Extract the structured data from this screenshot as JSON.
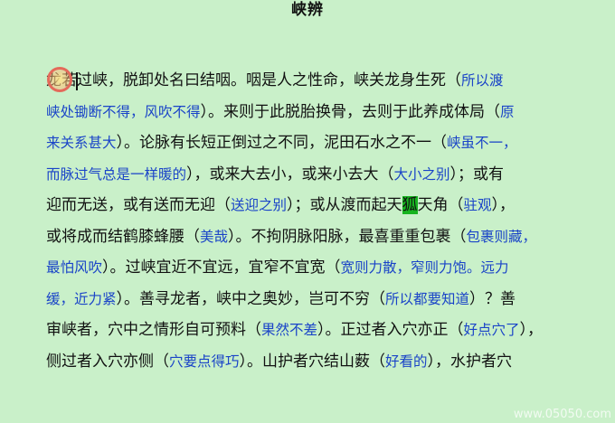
{
  "page": {
    "title": "峡辨"
  },
  "text": {
    "l1_a": "龙若过峡，脱卸处名曰结咽。咽是人之性命，峡关龙身生死（",
    "l1_b": "所以渡",
    "l2_a": "峡处锄断不得，风吹不得",
    "l2_b": "）。来则于此脱胎换骨，去则于此养成体局（",
    "l2_c": "原",
    "l3_a": "来关系甚大",
    "l3_b": "）。论脉有长短正倒过之不同，泥田石水之不一（",
    "l3_c": "峡虽不一，",
    "l4_a": "而脉过气总是一样暖的",
    "l4_b": "），或来大去小，或来小去大（",
    "l4_c": "大小之别",
    "l4_d": "）；或有",
    "l5_a": "迎而无送，或有送而无迎（",
    "l5_b": "送迎之别",
    "l5_c": "）；或从渡而起天",
    "l5_d": "狐",
    "l5_e": "天角（",
    "l5_f": "驻观",
    "l5_g": "），",
    "l6_a": "或将成而结鹤膝蜂腰（",
    "l6_b": "美哉",
    "l6_c": "）。不拘阴脉阳脉，最喜重重包裹（",
    "l6_d": "包裹则藏，",
    "l7_a": "最怕风吹",
    "l7_b": "）。过峡宜近不宜远，宜窄不宜宽（",
    "l7_c": "宽则力散，窄则力饱。远力",
    "l8_a": "缓，近力紧",
    "l8_b": "）。善寻龙者，峡中之奥妙，岂可不穷（",
    "l8_c": "所以都要知道",
    "l8_d": "）？善",
    "l9_a": "审峡者，穴中之情形自可预料（",
    "l9_b": "果然不差",
    "l9_c": "）。正过者入穴亦正（",
    "l9_d": "好点穴了",
    "l9_e": "），",
    "l10_a": "侧过者入穴亦侧（",
    "l10_b": "穴要点得巧",
    "l10_c": "）。山护者穴结山薮（",
    "l10_d": "好看的",
    "l10_e": "），水护者穴"
  },
  "watermark": "www.05050.com",
  "colors": {
    "background": "#c9f0c9",
    "annotation": "#1a44c8",
    "highlight": "#17b41f",
    "cursor_ring": "#e46a5a"
  },
  "icons": [
    "cursor-highlight-icon"
  ]
}
